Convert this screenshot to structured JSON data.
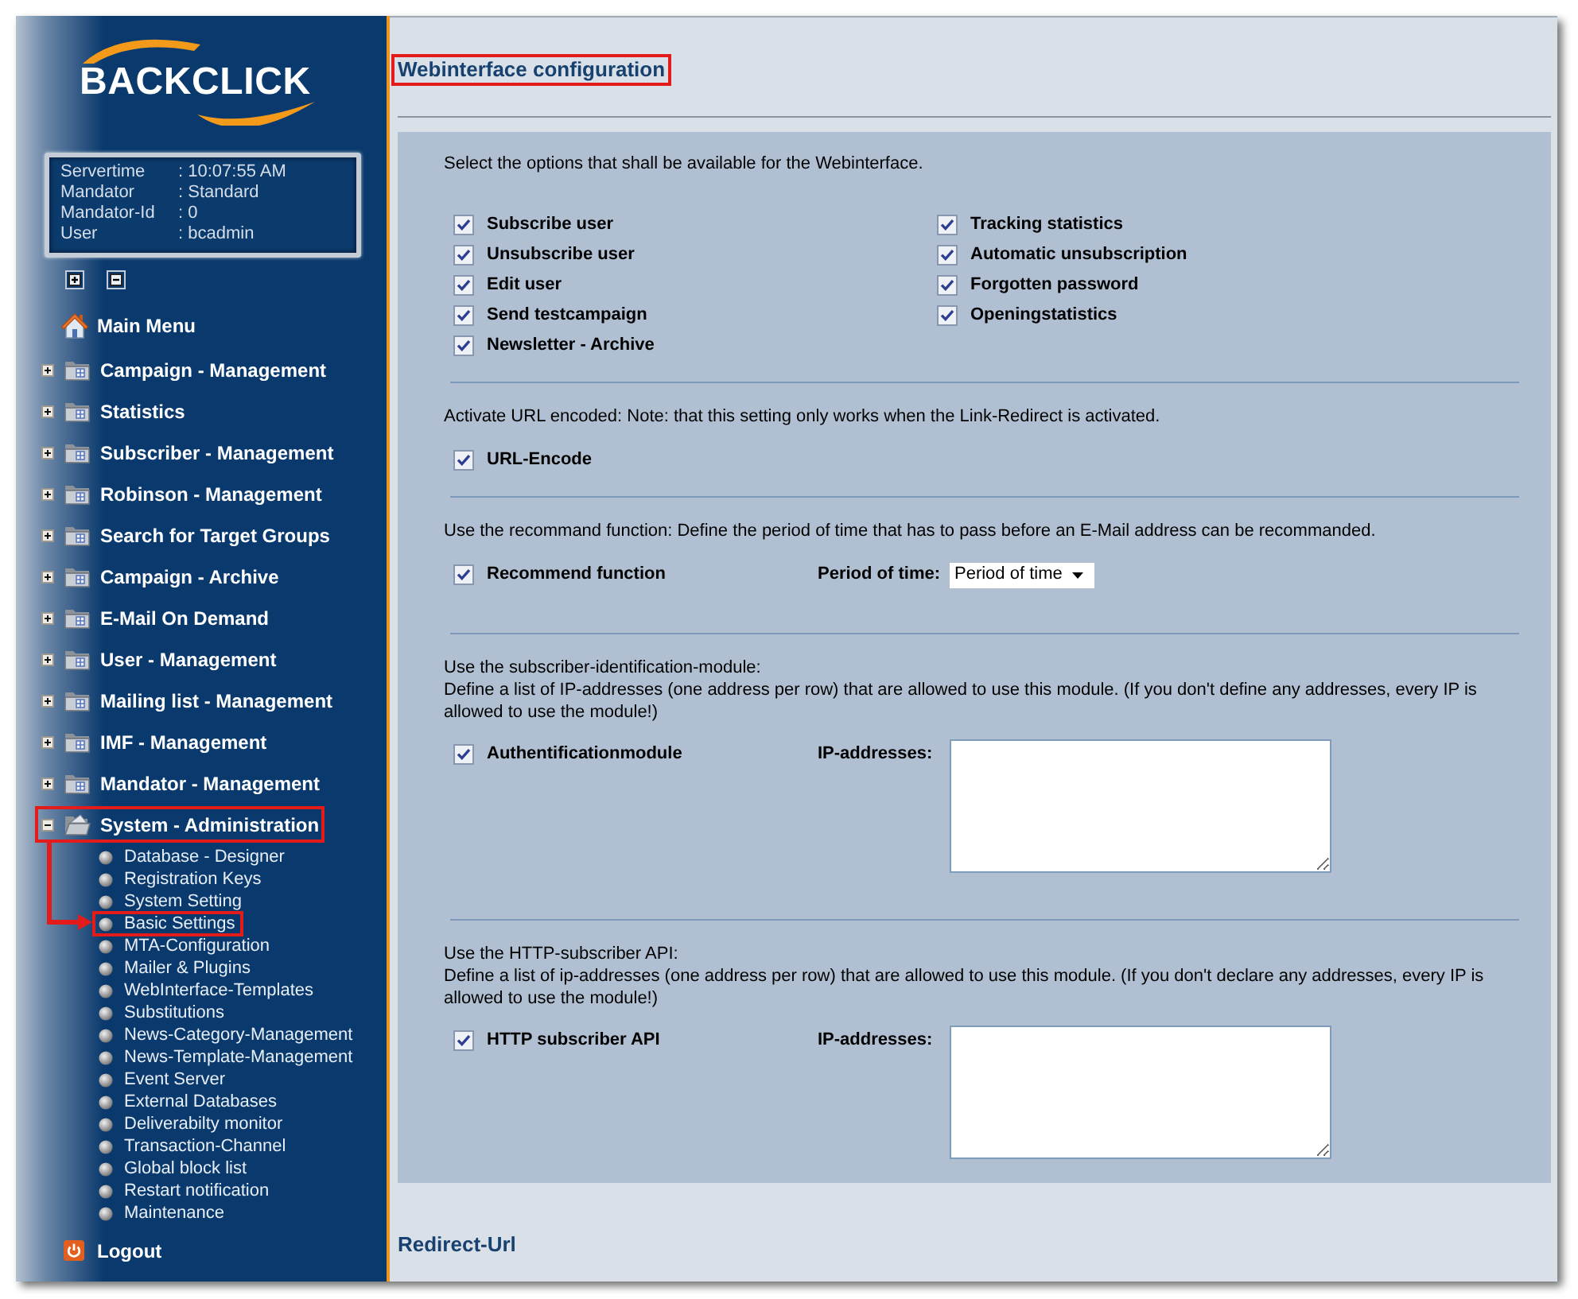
{
  "logo": {
    "text": "BACKCLICK"
  },
  "server_info": [
    {
      "label": "Servertime",
      "value": ": 10:07:55 AM"
    },
    {
      "label": "Mandator",
      "value": ": Standard"
    },
    {
      "label": "Mandator-Id",
      "value": ": 0"
    },
    {
      "label": "User",
      "value": ": bcadmin"
    }
  ],
  "main_menu": {
    "label": "Main Menu"
  },
  "menu": [
    {
      "label": "Campaign - Management",
      "expanded": false,
      "highlighted": false
    },
    {
      "label": "Statistics",
      "expanded": false,
      "highlighted": false
    },
    {
      "label": "Subscriber - Management",
      "expanded": false,
      "highlighted": false
    },
    {
      "label": "Robinson - Management",
      "expanded": false,
      "highlighted": false
    },
    {
      "label": "Search for Target Groups",
      "expanded": false,
      "highlighted": false
    },
    {
      "label": "Campaign - Archive",
      "expanded": false,
      "highlighted": false
    },
    {
      "label": "E-Mail On Demand",
      "expanded": false,
      "highlighted": false
    },
    {
      "label": "User - Management",
      "expanded": false,
      "highlighted": false
    },
    {
      "label": "Mailing list - Management",
      "expanded": false,
      "highlighted": false
    },
    {
      "label": "IMF - Management",
      "expanded": false,
      "highlighted": false
    },
    {
      "label": "Mandator - Management",
      "expanded": false,
      "highlighted": false
    },
    {
      "label": "System - Administration",
      "expanded": true,
      "highlighted": true,
      "children": [
        {
          "label": "Database - Designer",
          "highlighted": false
        },
        {
          "label": "Registration Keys",
          "highlighted": false
        },
        {
          "label": "System Setting",
          "highlighted": false
        },
        {
          "label": "Basic Settings",
          "highlighted": true
        },
        {
          "label": "MTA-Configuration",
          "highlighted": false
        },
        {
          "label": "Mailer & Plugins",
          "highlighted": false
        },
        {
          "label": "WebInterface-Templates",
          "highlighted": false
        },
        {
          "label": "Substitutions",
          "highlighted": false
        },
        {
          "label": "News-Category-Management",
          "highlighted": false
        },
        {
          "label": "News-Template-Management",
          "highlighted": false
        },
        {
          "label": "Event Server",
          "highlighted": false
        },
        {
          "label": "External Databases",
          "highlighted": false
        },
        {
          "label": "Deliverabilty monitor",
          "highlighted": false
        },
        {
          "label": "Transaction-Channel",
          "highlighted": false
        },
        {
          "label": "Global block list",
          "highlighted": false
        },
        {
          "label": "Restart notification",
          "highlighted": false
        },
        {
          "label": "Maintenance",
          "highlighted": false
        }
      ]
    }
  ],
  "logout": {
    "label": "Logout"
  },
  "page": {
    "heading": {
      "text": "Webinterface configuration",
      "highlighted": true
    },
    "sections": [
      {
        "kind": "options",
        "intro": [
          "Select the options that shall be available for the Webinterface."
        ],
        "columns": [
          [
            {
              "label": "Subscribe user",
              "checked": true
            },
            {
              "label": "Unsubscribe user",
              "checked": true
            },
            {
              "label": "Edit user",
              "checked": true
            },
            {
              "label": "Send testcampaign",
              "checked": true
            },
            {
              "label": "Newsletter - Archive",
              "checked": true
            }
          ],
          [
            {
              "label": "Tracking statistics",
              "checked": true
            },
            {
              "label": "Automatic unsubscription",
              "checked": true
            },
            {
              "label": "Forgotten password",
              "checked": true
            },
            {
              "label": "Openingstatistics",
              "checked": true
            }
          ]
        ]
      },
      {
        "kind": "option",
        "intro": [
          "Activate URL encoded: Note: that this setting only works when the Link-Redirect is activated."
        ],
        "option": {
          "label": "URL-Encode",
          "checked": true
        }
      },
      {
        "kind": "select",
        "intro": [
          "Use the recommand function: Define the period of time that has to pass before an E-Mail address can be recommanded."
        ],
        "option": {
          "label": "Recommend function",
          "checked": true
        },
        "field_label": "Period of time:",
        "field_value": "Period of time"
      },
      {
        "kind": "textarea",
        "intro": [
          "Use the subscriber-identification-module:",
          "Define a list of IP-addresses (one address per row) that are allowed to use this module. (If you don't define any addresses, every IP is allowed to use the module!)"
        ],
        "option": {
          "label": "Authentificationmodule",
          "checked": true
        },
        "field_label": "IP-addresses:"
      },
      {
        "kind": "textarea",
        "intro": [
          "Use the HTTP-subscriber API:",
          "Define a list of ip-addresses (one address per row) that are allowed to use this module. (If you don't declare any addresses, every IP is allowed to use the module!)"
        ],
        "option": {
          "label": "HTTP subscriber API",
          "checked": true
        },
        "field_label": "IP-addresses:"
      }
    ],
    "footer_heading": "Redirect-Url"
  }
}
